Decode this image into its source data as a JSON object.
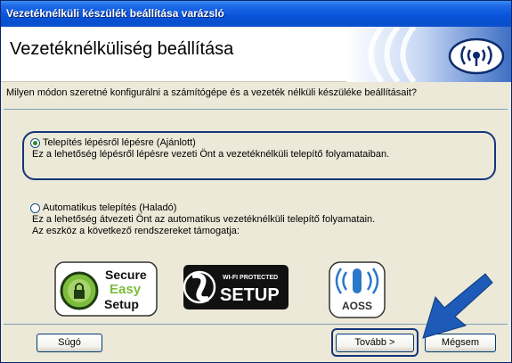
{
  "window": {
    "title": "Vezetéknélküli készülék beállítása varázsló"
  },
  "header": {
    "title": "Vezetéknélküliség beállítása",
    "icon": "wireless-signal-icon"
  },
  "question": "Milyen módon szeretné konfigurálni a számítógépe és a vezeték nélküli készüléke beállításait?",
  "options": [
    {
      "label": "Telepítés lépésről lépésre (Ajánlott)",
      "description": "Ez a lehetőség lépésről lépésre vezeti Önt a vezetéknélküli telepítő folyamataiban.",
      "selected": true
    },
    {
      "label": "Automatikus telepítés (Haladó)",
      "description": "Ez a lehetőség átvezeti Önt az automatikus vezetéknélküli telepítő folyamatain.",
      "description2": "Az eszköz a következő rendszereket támogatja:",
      "selected": false
    }
  ],
  "logos": {
    "secure_easy_setup": [
      "Secure",
      "Easy",
      "Setup"
    ],
    "wifi_protected_setup": [
      "WI-FI PROTECTED",
      "SETUP"
    ],
    "aoss": "AOSS"
  },
  "buttons": {
    "help": "Súgó",
    "next": "Tovább >",
    "cancel": "Mégsem"
  },
  "colors": {
    "titlebar": "#0a55dc",
    "dialog_bg": "#ece9d8",
    "highlight_border": "#14367a",
    "arrow": "#1e5bb8"
  }
}
